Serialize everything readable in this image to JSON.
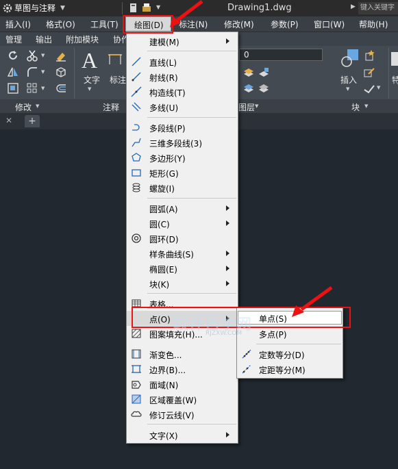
{
  "titlebar": {
    "workspace": "草图与注释",
    "document": "Drawing1.dwg",
    "search_placeholder": "键入关键字"
  },
  "menubar": {
    "items": [
      "插入(I)",
      "格式(O)",
      "工具(T)",
      "绘图(D)",
      "标注(N)",
      "修改(M)",
      "参数(P)",
      "窗口(W)",
      "帮助(H)"
    ]
  },
  "ribbon": {
    "tabs": [
      "管理",
      "输出",
      "附加模块",
      "协作"
    ],
    "text_button": "文字",
    "dim_button": "标注",
    "layer_value": "0",
    "insert_button": "插入",
    "right_partial": "特",
    "panels": {
      "modify": "修改",
      "annotate": "注释",
      "layers": "图层",
      "block": "块"
    }
  },
  "draw_menu": {
    "modeling": "建模(M)",
    "line": "直线(L)",
    "ray": "射线(R)",
    "xline": "构造线(T)",
    "mline": "多线(U)",
    "pline": "多段线(P)",
    "pline3d": "三维多段线(3)",
    "polygon": "多边形(Y)",
    "rectangle": "矩形(G)",
    "helix": "螺旋(I)",
    "arc": "圆弧(A)",
    "circle": "圆(C)",
    "donut": "圆环(D)",
    "spline": "样条曲线(S)",
    "ellipse": "椭圆(E)",
    "block": "块(K)",
    "table": "表格...",
    "point": "点(O)",
    "hatch": "图案填充(H)...",
    "gradient": "渐变色...",
    "boundary": "边界(B)...",
    "region": "面域(N)",
    "wipeout": "区域覆盖(W)",
    "revcloud": "修订云线(V)",
    "text": "文字(X)"
  },
  "point_submenu": {
    "single": "单点(S)",
    "multiple": "多点(P)",
    "divide": "定数等分(D)",
    "measure": "定距等分(M)"
  },
  "watermark": {
    "main": "软件自学网",
    "sub": "RJZXW.COM"
  }
}
